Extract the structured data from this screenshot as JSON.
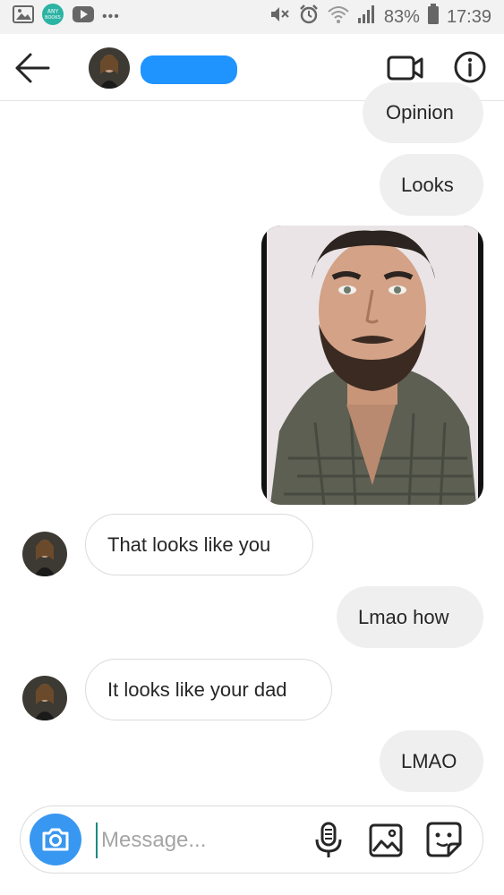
{
  "status_bar": {
    "icons_left": [
      "image-notification-icon",
      "anybooks-app-icon",
      "youtube-icon",
      "more-dots-icon"
    ],
    "anybooks_text": "ANY BOOKS",
    "more_text": "•••",
    "icons_right": [
      "mute-icon",
      "alarm-icon",
      "wifi-icon",
      "signal-icon",
      "battery-icon"
    ],
    "battery_percent": "83%",
    "time": "17:39"
  },
  "header": {
    "back_icon": "back-arrow-icon",
    "contact_name_redacted": true,
    "video_icon": "video-camera-icon",
    "info_icon": "info-icon"
  },
  "messages": [
    {
      "from": "me",
      "type": "text",
      "text": "Opinion"
    },
    {
      "from": "me",
      "type": "text",
      "text": "Looks"
    },
    {
      "from": "me",
      "type": "photo",
      "description_icon": "portrait-photo"
    },
    {
      "from": "them",
      "type": "text",
      "text": "That looks like you"
    },
    {
      "from": "me",
      "type": "text",
      "text": "Lmao how"
    },
    {
      "from": "them",
      "type": "text",
      "text": "It looks like your dad"
    },
    {
      "from": "me",
      "type": "text",
      "text": "LMAO"
    }
  ],
  "composer": {
    "placeholder": "Message...",
    "value": "",
    "icons": [
      "camera-icon",
      "microphone-icon",
      "gallery-icon",
      "sticker-icon"
    ]
  },
  "colors": {
    "accent_blue": "#3897f0",
    "sent_bubble": "#efefef",
    "received_border": "#dbdbdb",
    "redaction": "#1f94ff"
  }
}
